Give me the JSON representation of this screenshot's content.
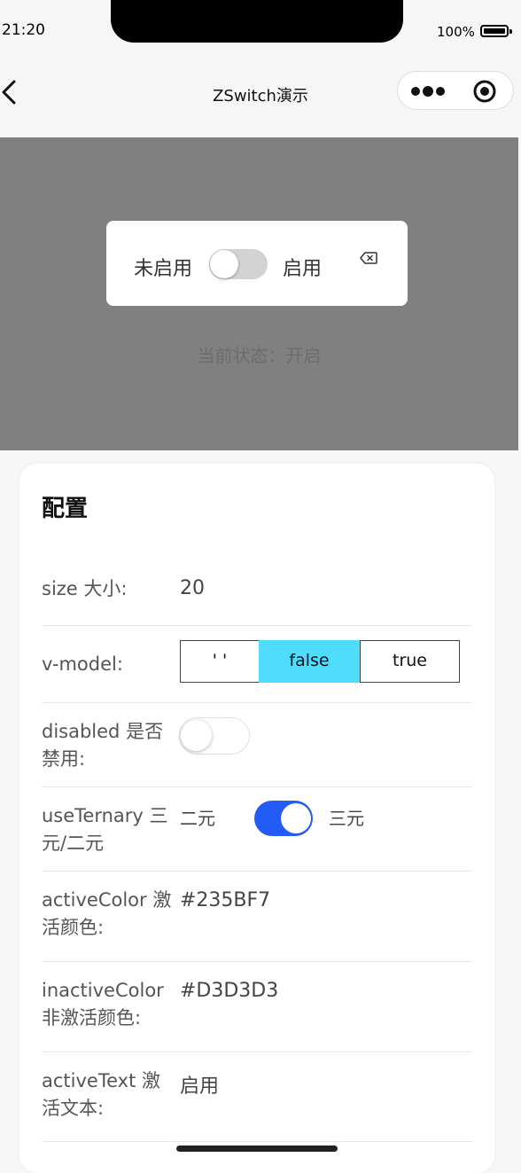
{
  "status_bar": {
    "time": "21:20",
    "battery_percent": "100%"
  },
  "nav": {
    "title": "ZSwitch演示",
    "back_icon": "chevron-left-icon",
    "more_icon": "more-dots-icon",
    "target_icon": "target-icon"
  },
  "preview": {
    "inactive_text": "未启用",
    "active_text": "启用",
    "switch_on": false,
    "clear_icon": "backspace-icon",
    "status_line": "当前状态：开启"
  },
  "config": {
    "title": "配置",
    "size": {
      "label": "size 大小:",
      "value": "20"
    },
    "vmodel": {
      "label": "v-model:",
      "options": [
        "' '",
        "false",
        "true"
      ],
      "selected": "false"
    },
    "disabled": {
      "label": "disabled 是否禁用:",
      "on": false
    },
    "use_ternary": {
      "label": "useTernary 三元/二元",
      "left_text": "二元",
      "right_text": "三元",
      "on": true
    },
    "active_color": {
      "label": "activeColor 激活颜色:",
      "value": "#235BF7"
    },
    "inactive_color": {
      "label": "inactiveColor 非激活颜色:",
      "value": "#D3D3D3"
    },
    "active_text": {
      "label": "activeText 激活文本:",
      "value": "启用"
    }
  },
  "colors": {
    "accent": "#235BF7",
    "inactive": "#D3D3D3",
    "selected_segment": "#4FDCFF",
    "overlay": "#808080"
  }
}
